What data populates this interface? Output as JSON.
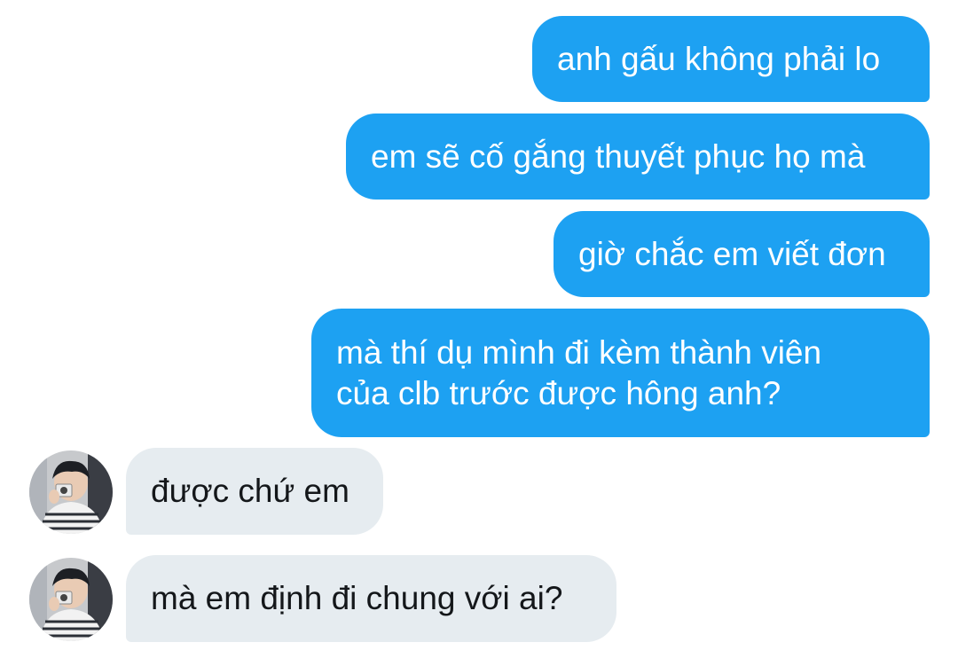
{
  "conversation": {
    "sent": [
      {
        "text": "anh gấu không phải lo"
      },
      {
        "text": "em sẽ cố gắng thuyết phục họ mà"
      },
      {
        "text": "giờ chắc em viết đơn"
      },
      {
        "text": "mà thí dụ mình đi kèm thành viên\ncủa clb trước được hông anh?"
      }
    ],
    "received": [
      {
        "text": "được chứ em",
        "avatar": "user-avatar-photo"
      },
      {
        "text": "mà em định đi chung với ai?",
        "avatar": "user-avatar-photo"
      }
    ]
  },
  "colors": {
    "sent_bubble": "#1da1f2",
    "received_bubble": "#e6ecf0",
    "sent_text": "#ffffff",
    "received_text": "#14171a"
  }
}
